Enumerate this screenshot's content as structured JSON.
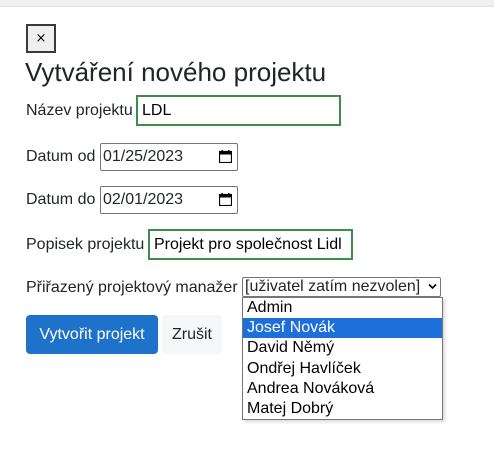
{
  "modal": {
    "close_label": "×",
    "title": "Vytváření nového projektu"
  },
  "form": {
    "name": {
      "label": "Název projektu",
      "value": "LDL"
    },
    "date_from": {
      "label": "Datum od",
      "value": "01/25/2023"
    },
    "date_to": {
      "label": "Datum do",
      "value": "02/01/2023"
    },
    "description": {
      "label": "Popisek projektu",
      "value": "Projekt pro společnost Lidl"
    },
    "manager": {
      "label": "Přiřazený projektový manažer",
      "selected": "[uživatel zatím nezvolen]",
      "options": [
        "Admin",
        "Josef Novák",
        "David Němý",
        "Ondřej Havlíček",
        "Andrea Nováková",
        "Matej Dobrý"
      ],
      "highlighted_option": "Josef Novák"
    }
  },
  "buttons": {
    "create_label": "Vytvořit projekt",
    "cancel_label": "Zrušit"
  },
  "icons": {
    "close": "close-icon",
    "calendar": "calendar-icon",
    "dropdown": "chevron-down-icon"
  },
  "colors": {
    "primary": "#1f72c9",
    "valid_border": "#3c8d4c",
    "option_highlight": "#1e6fd9"
  }
}
